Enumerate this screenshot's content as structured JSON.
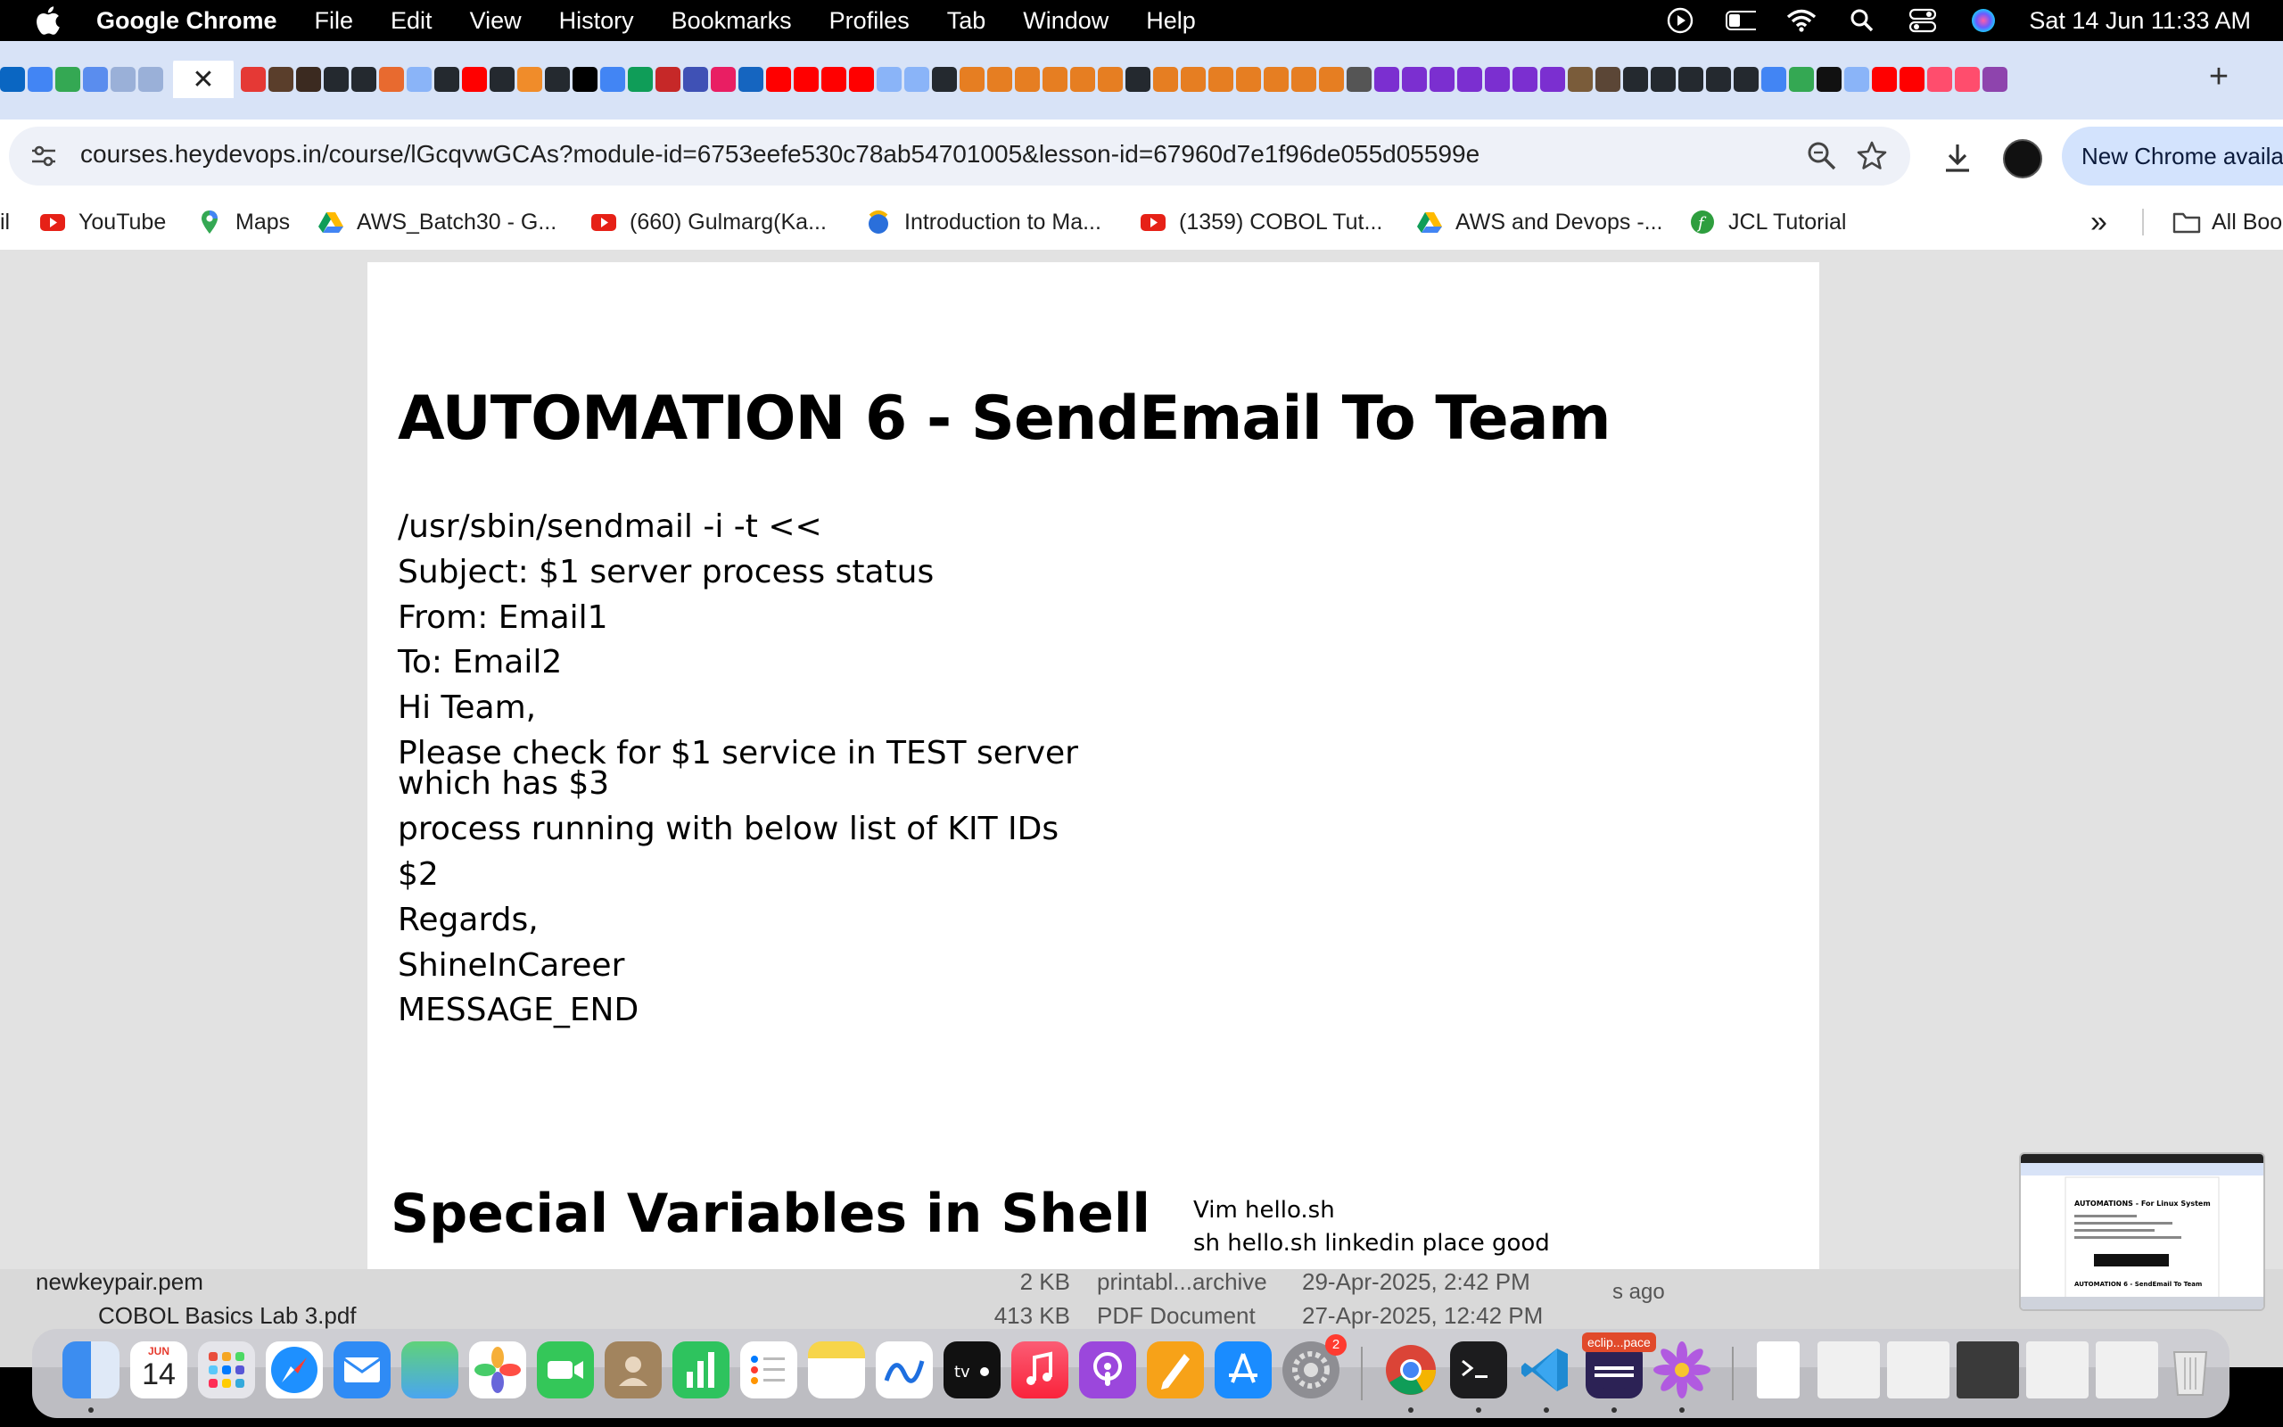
{
  "menubar": {
    "app": "Google Chrome",
    "items": [
      "File",
      "Edit",
      "View",
      "History",
      "Bookmarks",
      "Profiles",
      "Tab",
      "Window",
      "Help"
    ],
    "clock": "Sat 14 Jun  11:33 AM"
  },
  "tabs": {
    "active_close": "✕",
    "new_tab": "+"
  },
  "toolbar": {
    "url": "courses.heydevops.in/course/lGcqvwGCAs?module-id=6753eefe530c78ab54701005&lesson-id=67960d7e1f96de055d05599e",
    "update_label": "New Chrome availa"
  },
  "bookmarks": {
    "items": [
      {
        "label": "il"
      },
      {
        "label": "YouTube"
      },
      {
        "label": "Maps"
      },
      {
        "label": "AWS_Batch30 - G..."
      },
      {
        "label": "(660) Gulmarg(Ka..."
      },
      {
        "label": "Introduction to Ma..."
      },
      {
        "label": "(1359) COBOL Tut..."
      },
      {
        "label": "AWS and Devops -..."
      },
      {
        "label": "JCL Tutorial"
      },
      {
        "label": "All Boo"
      }
    ],
    "overflow": "»"
  },
  "slide": {
    "title": "AUTOMATION 6 - SendEmail To Team",
    "lines": [
      "/usr/sbin/sendmail -i -t <<",
      "Subject: $1 server process status",
      "From: Email1",
      "To: Email2",
      "Hi Team,",
      "Please check for $1 service in TEST server",
      "which has $3",
      "process running with below list of KIT IDs",
      "$2",
      "Regards,",
      "ShineInCareer",
      "MESSAGE_END"
    ],
    "next_heading": "Special Variables in Shell",
    "notes": [
      "Vim hello.sh",
      "sh hello.sh linkedin place good"
    ]
  },
  "finder": {
    "rows": [
      {
        "name": "newkeypair.pem",
        "size": "2 KB",
        "kind": "printabl...archive",
        "date": "29-Apr-2025, 2:42 PM"
      },
      {
        "name": "COBOL Basics Lab 3.pdf",
        "size": "413 KB",
        "kind": "PDF Document",
        "date": "27-Apr-2025, 12:42 PM"
      }
    ],
    "ago": "s ago"
  },
  "dock": {
    "calendar_month": "JUN",
    "calendar_day": "14",
    "settings_badge": "2",
    "eclipse_label": "eclip...pace"
  },
  "colors": {
    "menubar": "#000000",
    "tabstrip": "#d8e3f7",
    "omnibox": "#eef1f8",
    "update_chip": "#d3e3fd",
    "content_bg": "#e2e2e2"
  }
}
